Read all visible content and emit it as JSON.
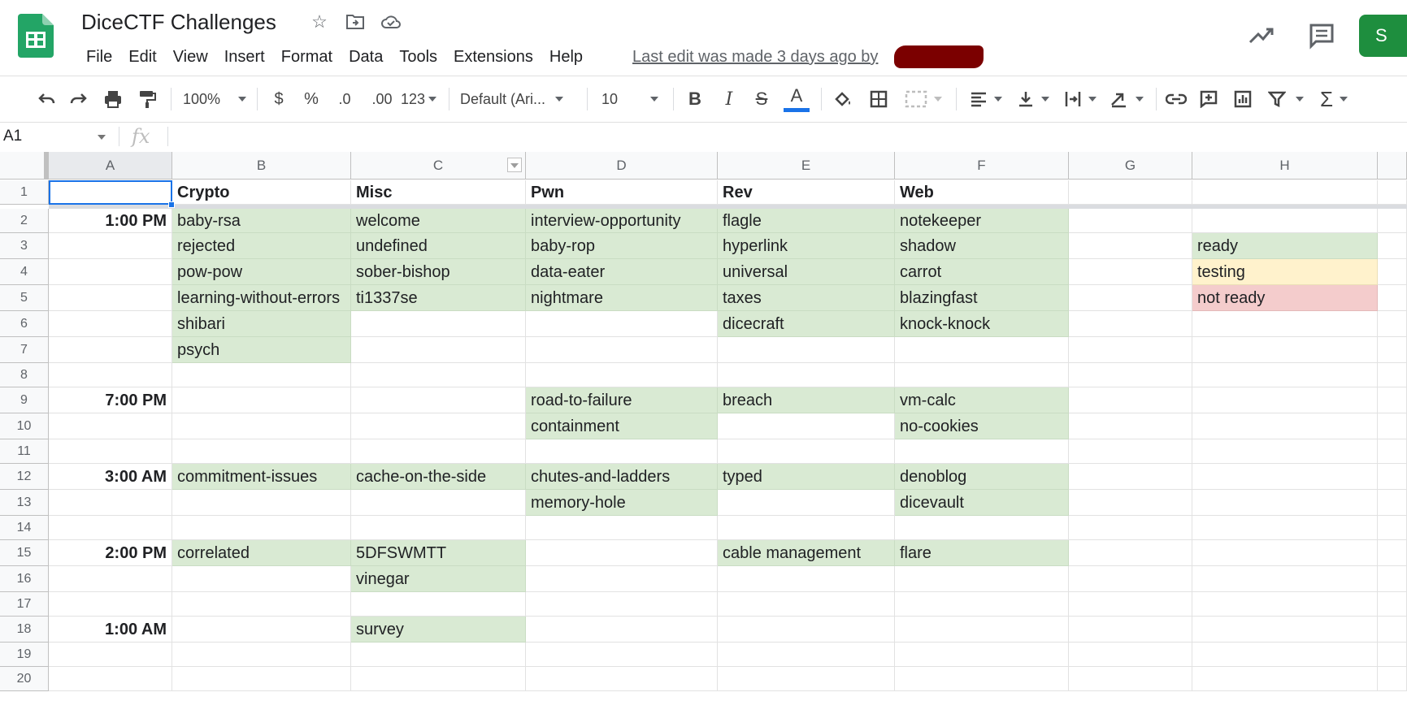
{
  "app": {
    "title": "DiceCTF Challenges",
    "menu": [
      "File",
      "Edit",
      "View",
      "Insert",
      "Format",
      "Data",
      "Tools",
      "Extensions",
      "Help"
    ],
    "last_edit": "Last edit was made 3 days ago by",
    "share_label": "S",
    "brand_color": "#1e8e3e"
  },
  "toolbar": {
    "zoom": "100%",
    "currency": "$",
    "percent": "%",
    "dec_decrease": ".0",
    "dec_increase": ".00",
    "more_formats": "123",
    "font": "Default (Ari...",
    "font_size": "10",
    "bold": "B",
    "italic": "I",
    "strike": "S",
    "text_color": "A"
  },
  "formula": {
    "name_box": "A1",
    "fx": "fx"
  },
  "columns": [
    "A",
    "B",
    "C",
    "D",
    "E",
    "F",
    "G",
    "H"
  ],
  "rows": [
    "1",
    "2",
    "3",
    "4",
    "5",
    "6",
    "7",
    "8",
    "9",
    "10",
    "11",
    "12",
    "13",
    "14",
    "15",
    "16",
    "17",
    "18",
    "19",
    "20"
  ],
  "headers": {
    "B": "Crypto",
    "C": "Misc",
    "D": "Pwn",
    "E": "Rev",
    "F": "Web"
  },
  "times": {
    "2": "1:00 PM",
    "9": "7:00 PM",
    "12": "3:00 AM",
    "15": "2:00 PM",
    "18": "1:00 AM"
  },
  "challenges": {
    "B": {
      "2": "baby-rsa",
      "3": "rejected",
      "4": "pow-pow",
      "5": "learning-without-errors",
      "6": "shibari",
      "7": "psych",
      "12": "commitment-issues",
      "15": "correlated"
    },
    "C": {
      "2": "welcome",
      "3": "undefined",
      "4": "sober-bishop",
      "5": "ti1337se",
      "12": "cache-on-the-side",
      "15": "5DFSWMTT",
      "16": "vinegar",
      "18": "survey"
    },
    "D": {
      "2": "interview-opportunity",
      "3": "baby-rop",
      "4": "data-eater",
      "5": "nightmare",
      "9": "road-to-failure",
      "10": "containment",
      "12": "chutes-and-ladders",
      "13": "memory-hole"
    },
    "E": {
      "2": "flagle",
      "3": "hyperlink",
      "4": "universal",
      "5": "taxes",
      "6": "dicecraft",
      "9": "breach",
      "12": "typed",
      "15": "cable management"
    },
    "F": {
      "2": "notekeeper",
      "3": "shadow",
      "4": "carrot",
      "5": "blazingfast",
      "6": "knock-knock",
      "9": "vm-calc",
      "10": "no-cookies",
      "12": "denoblog",
      "13": "dicevault",
      "15": "flare"
    }
  },
  "legend": {
    "ready": "ready",
    "testing": "testing",
    "not_ready": "not ready"
  },
  "colors": {
    "ready": "#d9ead3",
    "testing": "#fff2cc",
    "not_ready": "#f4cccc",
    "selection": "#1a73e8"
  }
}
